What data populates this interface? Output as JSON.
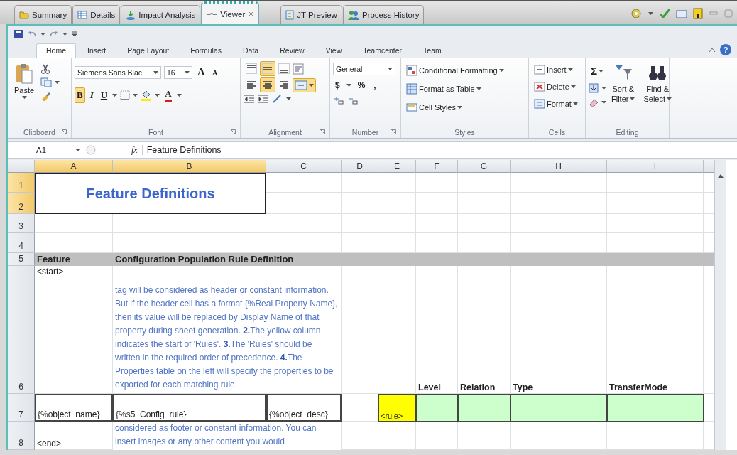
{
  "editor_tabs": [
    {
      "label": "Summary",
      "selected": false
    },
    {
      "label": "Details",
      "selected": false
    },
    {
      "label": "Impact Analysis",
      "selected": false
    },
    {
      "label": "Viewer",
      "selected": true
    },
    {
      "label": "JT Preview",
      "selected": false
    },
    {
      "label": "Process History",
      "selected": false
    }
  ],
  "ribbon": {
    "tabs": [
      {
        "label": "Home",
        "selected": true
      },
      {
        "label": "Insert",
        "selected": false
      },
      {
        "label": "Page Layout",
        "selected": false
      },
      {
        "label": "Formulas",
        "selected": false
      },
      {
        "label": "Data",
        "selected": false
      },
      {
        "label": "Review",
        "selected": false
      },
      {
        "label": "View",
        "selected": false
      },
      {
        "label": "Teamcenter",
        "selected": false
      },
      {
        "label": "Team",
        "selected": false
      }
    ],
    "help": "?"
  },
  "clipboard": {
    "label": "Clipboard",
    "paste": "Paste"
  },
  "font": {
    "label": "Font",
    "name": "Siemens Sans Blac",
    "size": "16",
    "grow": "A",
    "shrink": "A",
    "color_button": "A",
    "buttons": [
      {
        "kind": "bold",
        "label": "B",
        "selected": true
      },
      {
        "kind": "italic",
        "label": "I",
        "selected": false
      },
      {
        "kind": "underline",
        "label": "U",
        "selected": false
      }
    ]
  },
  "alignment": {
    "label": "Alignment",
    "merge_selected": true,
    "buttons": [
      {
        "kind": "top",
        "selected": false
      },
      {
        "kind": "middle",
        "selected": true
      },
      {
        "kind": "bottom",
        "selected": false
      },
      {
        "kind": "left",
        "selected": false
      },
      {
        "kind": "center",
        "selected": true
      },
      {
        "kind": "right",
        "selected": false
      }
    ]
  },
  "number": {
    "label": "Number",
    "format": "General",
    "symbols": [
      "$",
      "%",
      ","
    ]
  },
  "styles": {
    "label": "Styles",
    "items": [
      "Conditional Formatting",
      "Format as Table",
      "Cell Styles"
    ]
  },
  "cells": {
    "label": "Cells",
    "items": [
      "Insert",
      "Delete",
      "Format"
    ]
  },
  "editing": {
    "label": "Editing",
    "sum": "Σ",
    "sort": [
      "Sort &",
      "Filter"
    ],
    "find": [
      "Find &",
      "Select"
    ]
  },
  "formula_bar": {
    "cell": "A1",
    "function_label": "fx",
    "formula": "Feature Definitions"
  },
  "sheet": {
    "columns": [
      {
        "label": "A",
        "selected": true
      },
      {
        "label": "B",
        "selected": true
      },
      {
        "label": "C",
        "selected": false
      },
      {
        "label": "D",
        "selected": false
      },
      {
        "label": "E",
        "selected": false
      },
      {
        "label": "F",
        "selected": false
      },
      {
        "label": "G",
        "selected": false
      },
      {
        "label": "H",
        "selected": false
      },
      {
        "label": "I",
        "selected": false
      }
    ],
    "rows": [
      {
        "label": "1",
        "selected": true
      },
      {
        "label": "2",
        "selected": true
      },
      {
        "label": "3",
        "selected": false
      },
      {
        "label": "4",
        "selected": false
      },
      {
        "label": "5",
        "selected": false
      },
      {
        "label": "6",
        "selected": false
      },
      {
        "label": "7",
        "selected": false
      },
      {
        "label": "8",
        "selected": false
      }
    ],
    "title": "Feature Definitions",
    "header": {
      "feature": "Feature",
      "definition": "Configuration Population Rule Definition"
    },
    "start_row": {
      "tag": "<start>",
      "description": "tag will be considered as header or constant information. But if the header cell has a format {%Real Property Name}, then its value will be replaced by Display Name of that property during sheet generation. **2.**The yellow column indicates the start of 'Rules'.  **3.**The 'Rules' should be written in the required order of precedence. **4.**The Properties table on the left will specify the properties to be exported for each matching rule."
    },
    "rule_headers": [
      "Level",
      "Relation",
      "Type",
      "TransferMode"
    ],
    "template_row": {
      "name": "{%object_name}",
      "rule": "{%s5_Config_rule}",
      "desc": "{%object_desc}",
      "marker": "<rule>"
    },
    "end_row": {
      "tag": "<end>",
      "description": "considered as footer or constant information. You can insert images or any other content you would"
    }
  }
}
